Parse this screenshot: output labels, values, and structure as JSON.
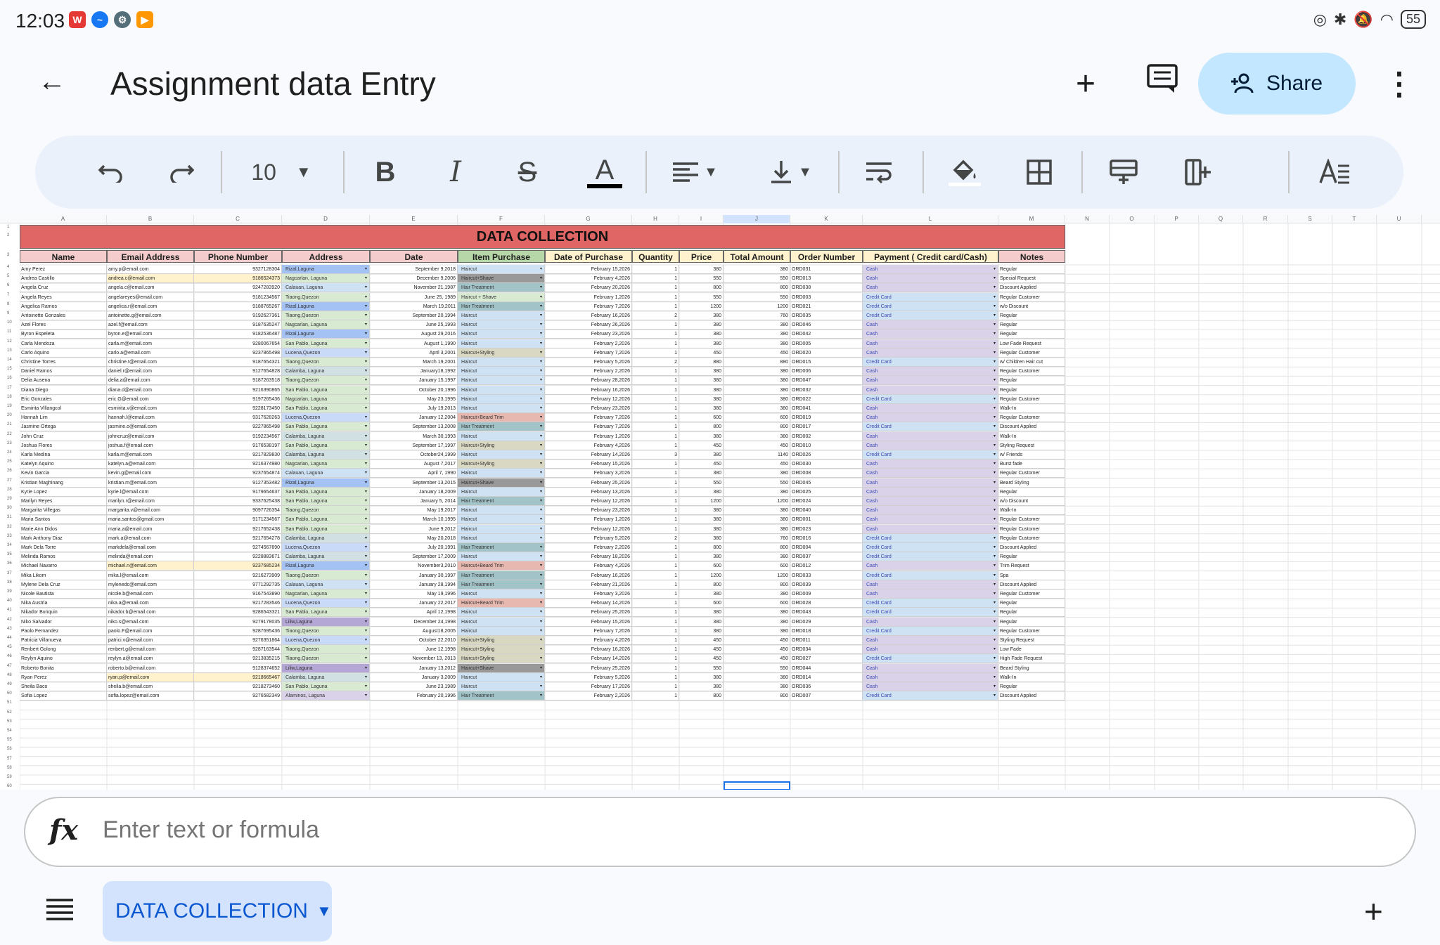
{
  "status": {
    "time": "12:03",
    "battery": "55"
  },
  "header": {
    "back": "←",
    "title": "Assignment data Entry",
    "add": "+",
    "comment": "▤",
    "share": "Share",
    "more": "⋮"
  },
  "toolbar": {
    "font_size": "10"
  },
  "sheet": {
    "banner": "DATA COLLECTION",
    "columns": [
      "A",
      "B",
      "C",
      "D",
      "E",
      "F",
      "G",
      "H",
      "I",
      "J",
      "K",
      "L",
      "M",
      "N",
      "O",
      "P",
      "Q",
      "R",
      "S",
      "T",
      "U"
    ],
    "headers": [
      "Name",
      "Email Address",
      "Phone Number",
      "Address",
      "Date",
      "Item Purchase",
      "Date of Purchase",
      "Quantity",
      "Price",
      "Total Amount",
      "Order Number",
      "Payment ( Credit card/Cash)",
      "Notes"
    ],
    "rows": [
      [
        "Amy Perez",
        "amy.p@email.com",
        "9327128304",
        "Rizal,Laguna",
        "September 9,2018",
        "Haircut",
        "February 15,2026",
        "1",
        "380",
        "380",
        "ORD031",
        "Cash",
        "Regular"
      ],
      [
        "Andrea Castillo",
        "andrea.c@email.com",
        "9186524373",
        "Nagcarlan, Laguna",
        "December 9,2006",
        "Haircut+Shave",
        "February 4,2026",
        "1",
        "550",
        "550",
        "ORD013",
        "Cash",
        "Special Request"
      ],
      [
        "Angela Cruz",
        "angela.c@email.com",
        "9247283920",
        "Calauan, Laguna",
        "November 21,1987",
        "Hair Treatment",
        "February 20,2026",
        "1",
        "800",
        "800",
        "ORD038",
        "Cash",
        "Discount Applied"
      ],
      [
        "Angela Reyes",
        "angelareyes@email.com",
        "9181234567",
        "Tiaong,Quezon",
        "June 25, 1989",
        "Haircut + Shave",
        "February 1,2026",
        "1",
        "550",
        "550",
        "ORD003",
        "Credit Card",
        "Regular Customer"
      ],
      [
        "Angelica Ramos",
        "angelica.r@email.com",
        "9188765267",
        "Rizal,Laguna",
        "March 19,2011",
        "Hair Treatment",
        "February 7,2026",
        "1",
        "1200",
        "1200",
        "ORD021",
        "Credit Card",
        "w/o Discount"
      ],
      [
        "Antoinette Gonzales",
        "antoinette.g@email.com",
        "9192627361",
        "Tiaong,Quezon",
        "September 20,1994",
        "Haircut",
        "February 16,2026",
        "2",
        "380",
        "760",
        "ORD035",
        "Credit Card",
        "Regular"
      ],
      [
        "Azel Flores",
        "azel.f@email.com",
        "9187635247",
        "Nagcarlan, Laguna",
        "June 25,1993",
        "Haircut",
        "February 26,2026",
        "1",
        "380",
        "380",
        "ORD046",
        "Cash",
        "Regular"
      ],
      [
        "Byron Espeleta",
        "byron.e@email.com",
        "9182536487",
        "Rizal,Laguna",
        "August 29,2016",
        "Haircut",
        "February 23,2026",
        "1",
        "380",
        "380",
        "ORD042",
        "Cash",
        "Regular"
      ],
      [
        "Carla Mendoza",
        "carla.m@email.com",
        "9280067654",
        "San Pablo, Laguna",
        "August 1,1990",
        "Haircut",
        "February 2,2026",
        "1",
        "380",
        "380",
        "ORD005",
        "Cash",
        "Low Fade Request"
      ],
      [
        "Carlo Aquino",
        "carlo.a@email.com",
        "9237865498",
        "Lucena,Quezon",
        "April 3,2001",
        "Haircut+Styling",
        "February 7,2026",
        "1",
        "450",
        "450",
        "ORD020",
        "Cash",
        "Regular Customer"
      ],
      [
        "Christine Torres",
        "christine.t@email.com",
        "9187654321",
        "Tiaong,Quezon",
        "March 19,2001",
        "Haircut",
        "February 5,2026",
        "2",
        "880",
        "880",
        "ORD015",
        "Credit Card",
        "w/ Children Hair cut"
      ],
      [
        "Daniel Ramos",
        "daniel.r@email.com",
        "9127654828",
        "Calamba, Laguna",
        "January18,1992",
        "Haircut",
        "February 2,2026",
        "1",
        "380",
        "380",
        "ORD006",
        "Cash",
        "Regular Customer"
      ],
      [
        "Delia Ausena",
        "delia.a@email.com",
        "9187263518",
        "Tiaong,Quezon",
        "January 15,1997",
        "Haircut",
        "February 28,2026",
        "1",
        "380",
        "380",
        "ORD047",
        "Cash",
        "Regular"
      ],
      [
        "Diana Diego",
        "diana.d@email.com",
        "9216390865",
        "San Pablo, Laguna",
        "October 20,1996",
        "Haircut",
        "February 16,2026",
        "1",
        "380",
        "380",
        "ORD032",
        "Cash",
        "Regular"
      ],
      [
        "Eric Gonzales",
        "eric.G@email.com",
        "9197265436",
        "Nagcarlan, Laguna",
        "May 23,1995",
        "Haircut",
        "February 12,2026",
        "1",
        "380",
        "380",
        "ORD022",
        "Credit Card",
        "Regular Customer"
      ],
      [
        "Esmirita Villangcol",
        "esmirita.v@email.com",
        "9228173450",
        "San Pablo, Laguna",
        "July 19,2013",
        "Haircut",
        "February 23,2026",
        "1",
        "380",
        "380",
        "ORD041",
        "Cash",
        "Walk-In"
      ],
      [
        "Hannah Lim",
        "hannah.l@email.com",
        "9317628263",
        "Lucena,Quezon",
        "January 12,2004",
        "Haircut+Beard Trim",
        "February 7,2026",
        "1",
        "600",
        "600",
        "ORD019",
        "Cash",
        "Regular Customer"
      ],
      [
        "Jasmine Ortega",
        "jasmine.o@email.com",
        "9227865498",
        "San Pablo, Laguna",
        "September 13,2008",
        "Hair Treatment",
        "February 7,2026",
        "1",
        "800",
        "800",
        "ORD017",
        "Credit Card",
        "Discount Applied"
      ],
      [
        "John Cruz",
        "johncruz@email.com",
        "9192234567",
        "Calamba, Laguna",
        "March 30,1993",
        "Haircut",
        "February 1,2026",
        "1",
        "380",
        "380",
        "ORD002",
        "Cash",
        "Walk-In"
      ],
      [
        "Joshua Flores",
        "joshua.f@email.com",
        "9176538197",
        "San Pablo, Laguna",
        "September 17,1997",
        "Haircut+Styling",
        "February 4,2026",
        "1",
        "450",
        "450",
        "ORD010",
        "Cash",
        "Styling Request"
      ],
      [
        "Karla Medina",
        "karla.m@email.com",
        "9217829830",
        "Calamba, Laguna",
        "October24,1999",
        "Haircut",
        "February 14,2026",
        "3",
        "380",
        "1140",
        "ORD026",
        "Credit Card",
        "w/ Friends"
      ],
      [
        "Katelyn Aquino",
        "katelyn.a@email.com",
        "9216374980",
        "Nagcarlan, Laguna",
        "August 7,2017",
        "Haircut+Styling",
        "February 15,2026",
        "1",
        "450",
        "450",
        "ORD030",
        "Cash",
        "Burst fade"
      ],
      [
        "Kevin Garcia",
        "kevin.g@email.com",
        "9237654874",
        "Calauan, Laguna",
        "April 7, 1990",
        "Haircut",
        "February 3,2026",
        "1",
        "380",
        "380",
        "ORD008",
        "Cash",
        "Regular Customer"
      ],
      [
        "Kristian Maghinang",
        "kristian.m@email.com",
        "9127353482",
        "Rizal,Laguna",
        "September 13,2015",
        "Haircut+Shave",
        "February 25,2026",
        "1",
        "550",
        "550",
        "ORD045",
        "Cash",
        "Beard Styling"
      ],
      [
        "Kyrie Lopez",
        "kyrie.l@email.com",
        "9179654637",
        "San Pablo, Laguna",
        "January 18,2009",
        "Haircut",
        "February 13,2026",
        "1",
        "380",
        "380",
        "ORD025",
        "Cash",
        "Regular"
      ],
      [
        "Marilyn Reyes",
        "marilyn.r@email.com",
        "9337625438",
        "San Pablo, Laguna",
        "January 5, 2014",
        "Hair Treatment",
        "February 12,2026",
        "1",
        "1200",
        "1200",
        "ORD024",
        "Cash",
        "w/o Discount"
      ],
      [
        "Margarita Villegas",
        "margarita.v@email.com",
        "9097726354",
        "Tiaong,Quezon",
        "May 19,2017",
        "Haircut",
        "February 23,2026",
        "1",
        "380",
        "380",
        "ORD040",
        "Cash",
        "Walk-In"
      ],
      [
        "Maria Santos",
        "maria.santos@gmail.com",
        "9171234567",
        "San Pablo, Laguna",
        "March 10,1995",
        "Haircut",
        "February 1,2026",
        "1",
        "380",
        "380",
        "ORD001",
        "Cash",
        "Regular Customer"
      ],
      [
        "Marie Ann Didos",
        "maria.a@email.com",
        "9217652438",
        "San Pablo, Laguna",
        "June 9,2012",
        "Haircut",
        "February 12,2026",
        "1",
        "380",
        "380",
        "ORD023",
        "Cash",
        "Regular Customer"
      ],
      [
        "Mark Anthony Diaz",
        "mark.a@email.com",
        "9217654278",
        "Calamba, Laguna",
        "May 20,2018",
        "Haircut",
        "February 5,2026",
        "2",
        "380",
        "760",
        "ORD016",
        "Credit Card",
        "Regular Customer"
      ],
      [
        "Mark Dela Torre",
        "markdela@email.com",
        "9274567890",
        "Lucena,Quezon",
        "July 20,1991",
        "Hair Treatment",
        "February 2,2026",
        "1",
        "800",
        "800",
        "ORD004",
        "Credit Card",
        "Discount Applied"
      ],
      [
        "Melinda Ramos",
        "melinda@email.com",
        "9228883671",
        "Calamba, Laguna",
        "September 17,2009",
        "Haircut",
        "February 18,2026",
        "1",
        "380",
        "380",
        "ORD037",
        "Credit Card",
        "Regular"
      ],
      [
        "Michael Navarro",
        "michael.n@email.com",
        "9237685234",
        "Rizal,Laguna",
        "November3,2010",
        "Haircut+Beard Trim",
        "February 4,2026",
        "1",
        "600",
        "600",
        "ORD012",
        "Cash",
        "Trim Request"
      ],
      [
        "Mika Likom",
        "mika.l@email.com",
        "9216273909",
        "Tiaong,Quezon",
        "January 30,1997",
        "Hair Treatment",
        "February 16,2026",
        "1",
        "1200",
        "1200",
        "ORD033",
        "Credit Card",
        "Spa"
      ],
      [
        "Mylene Dela Cruz",
        "mylenedc@email.com",
        "9771292735",
        "Calauan, Laguna",
        "January 28,1994",
        "Hair Treatment",
        "February 21,2026",
        "1",
        "800",
        "800",
        "ORD039",
        "Cash",
        "Discount Applied"
      ],
      [
        "Nicole Bautista",
        "nicole.b@email.com",
        "9167543890",
        "Nagcarlan, Laguna",
        "May 19,1996",
        "Haircut",
        "February 3,2026",
        "1",
        "380",
        "380",
        "ORD009",
        "Cash",
        "Regular Customer"
      ],
      [
        "Nika Austria",
        "nika.a@email.com",
        "9217283546",
        "Lucena,Quezon",
        "January 22,2017",
        "Haircut+Beard Trim",
        "February 14,2026",
        "1",
        "600",
        "600",
        "ORD028",
        "Credit Card",
        "Regular"
      ],
      [
        "Nikador Bunquin",
        "nikador.b@email.com",
        "9286543321",
        "San Pablo, Laguna",
        "April 12,1998",
        "Haircut",
        "February 25,2026",
        "1",
        "380",
        "380",
        "ORD043",
        "Credit Card",
        "Regular"
      ],
      [
        "Niko Salvador",
        "niko.s@email.com",
        "9279178035",
        "Liliw,Laguna",
        "December 24,1998",
        "Haircut",
        "February 15,2026",
        "1",
        "380",
        "380",
        "ORD029",
        "Cash",
        "Regular"
      ],
      [
        "Paolo Fernandez",
        "paolo.F@email.com",
        "9287695436",
        "Tiaong,Quezon",
        "August18,2005",
        "Haircut",
        "February 7,2026",
        "1",
        "380",
        "380",
        "ORD018",
        "Credit Card",
        "Regular Customer"
      ],
      [
        "Patricia Villanueva",
        "patrici.v@email.com",
        "9276351864",
        "Lucena,Quezon",
        "October 22,2010",
        "Haircut+Styling",
        "February 4,2026",
        "1",
        "450",
        "450",
        "ORD011",
        "Cash",
        "Styling Request"
      ],
      [
        "Renbert Golong",
        "renbert.g@email.com",
        "9287163544",
        "Tiaong,Quezon",
        "June 12,1998",
        "Haircut+Styling",
        "February 16,2026",
        "1",
        "450",
        "450",
        "ORD034",
        "Cash",
        "Low Fade"
      ],
      [
        "Reylyn Aquino",
        "reylyn.a@email.com",
        "9213835215",
        "Tiaong,Quezon",
        "November 13, 2013",
        "Haircut+Styling",
        "February 14,2026",
        "1",
        "450",
        "450",
        "ORD027",
        "Credit Card",
        "High Fade Request"
      ],
      [
        "Roberto Bonita",
        "roberto.b@email.com",
        "9128374652",
        "Liliw,Laguna",
        "January 13,2012",
        "Haircut+Shave",
        "February 25,2026",
        "1",
        "550",
        "550",
        "ORD044",
        "Cash",
        "Beard Styling"
      ],
      [
        "Ryan Perez",
        "ryan.p@email.com",
        "9218665467",
        "Calamba, Laguna",
        "January 3,2009",
        "Haircut",
        "February 5,2026",
        "1",
        "380",
        "380",
        "ORD014",
        "Cash",
        "Walk-In"
      ],
      [
        "Sheila Baco",
        "sheila.b@email.com",
        "9218273460",
        "San Pablo, Laguna",
        "June 23,1989",
        "Haircut",
        "February 17,2026",
        "1",
        "380",
        "380",
        "ORD036",
        "Cash",
        "Regular"
      ],
      [
        "Sofia Lopez",
        "sofia.lopez@email.com",
        "9276582349",
        "Alaminos, Laguna",
        "February 20,1996",
        "Hair Treatment",
        "February 2,2026",
        "1",
        "800",
        "800",
        "ORD007",
        "Credit Card",
        "Discount Applied"
      ]
    ]
  },
  "formula": {
    "placeholder": "Enter text or formula"
  },
  "bottom": {
    "sheet_tab": "DATA COLLECTION",
    "add": "+"
  },
  "colors": {
    "banner": "#e06666",
    "share_bg": "#c2e7ff",
    "tab_bg": "#d3e3fd",
    "toolbar_bg": "#eaf1fb"
  }
}
